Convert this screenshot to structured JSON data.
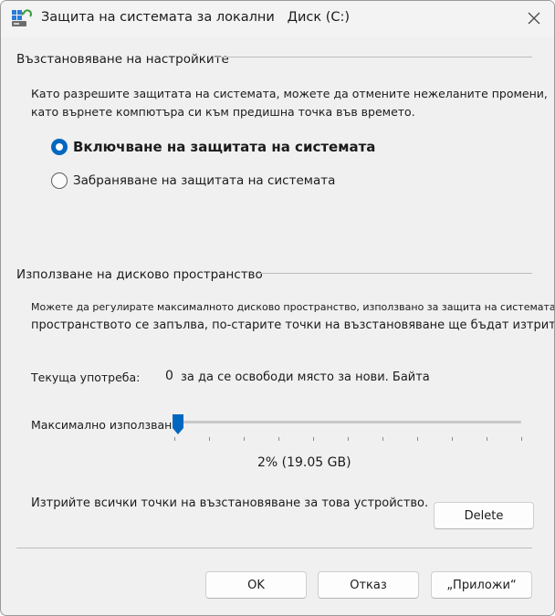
{
  "window": {
    "title": "Защита на системата за локални   Диск (C:)"
  },
  "restore_settings": {
    "header": "Възстановяване на настройките",
    "description": "Като разрешите защитата на системата, можете да отмените нежеланите промени, като върнете компютъра си към предишна точка във времето.",
    "description_line1": "Като разрешите защитата на системата, можете да отмените нежеланите промени,",
    "description_line2": "като върнете компютъра си към предишна точка във времето.",
    "option_on": "Включване на защитата на системата",
    "option_off": "Забраняване на защитата на системата",
    "selected": "on"
  },
  "disk_usage": {
    "header": "Използване на дисково пространство",
    "description_line1": "Можете да регулирате максималното дисково пространство, използвано за защита на системата. Когато",
    "description_line2": "пространството се запълва, по-старите точки на възстановяване ще бъдат изтрити,",
    "current_usage_label": "Текуща употреба:",
    "current_usage_value": "0",
    "current_usage_suffix": "за да се освободи място за нови. Байта",
    "max_usage_label": "Максимално използване:",
    "max_usage_percent": 2,
    "max_usage_display": "2% (19.05 GB)",
    "delete_text": "Изтрийте всички точки на възстановяване за това устройство.",
    "delete_button": "Delete"
  },
  "buttons": {
    "ok": "OK",
    "cancel": "Отказ",
    "apply": "„Приложи“"
  },
  "colors": {
    "accent": "#0067c0",
    "background": "#f0f0f0"
  },
  "icons": {
    "app": "system-protection-icon",
    "close": "close-icon"
  }
}
